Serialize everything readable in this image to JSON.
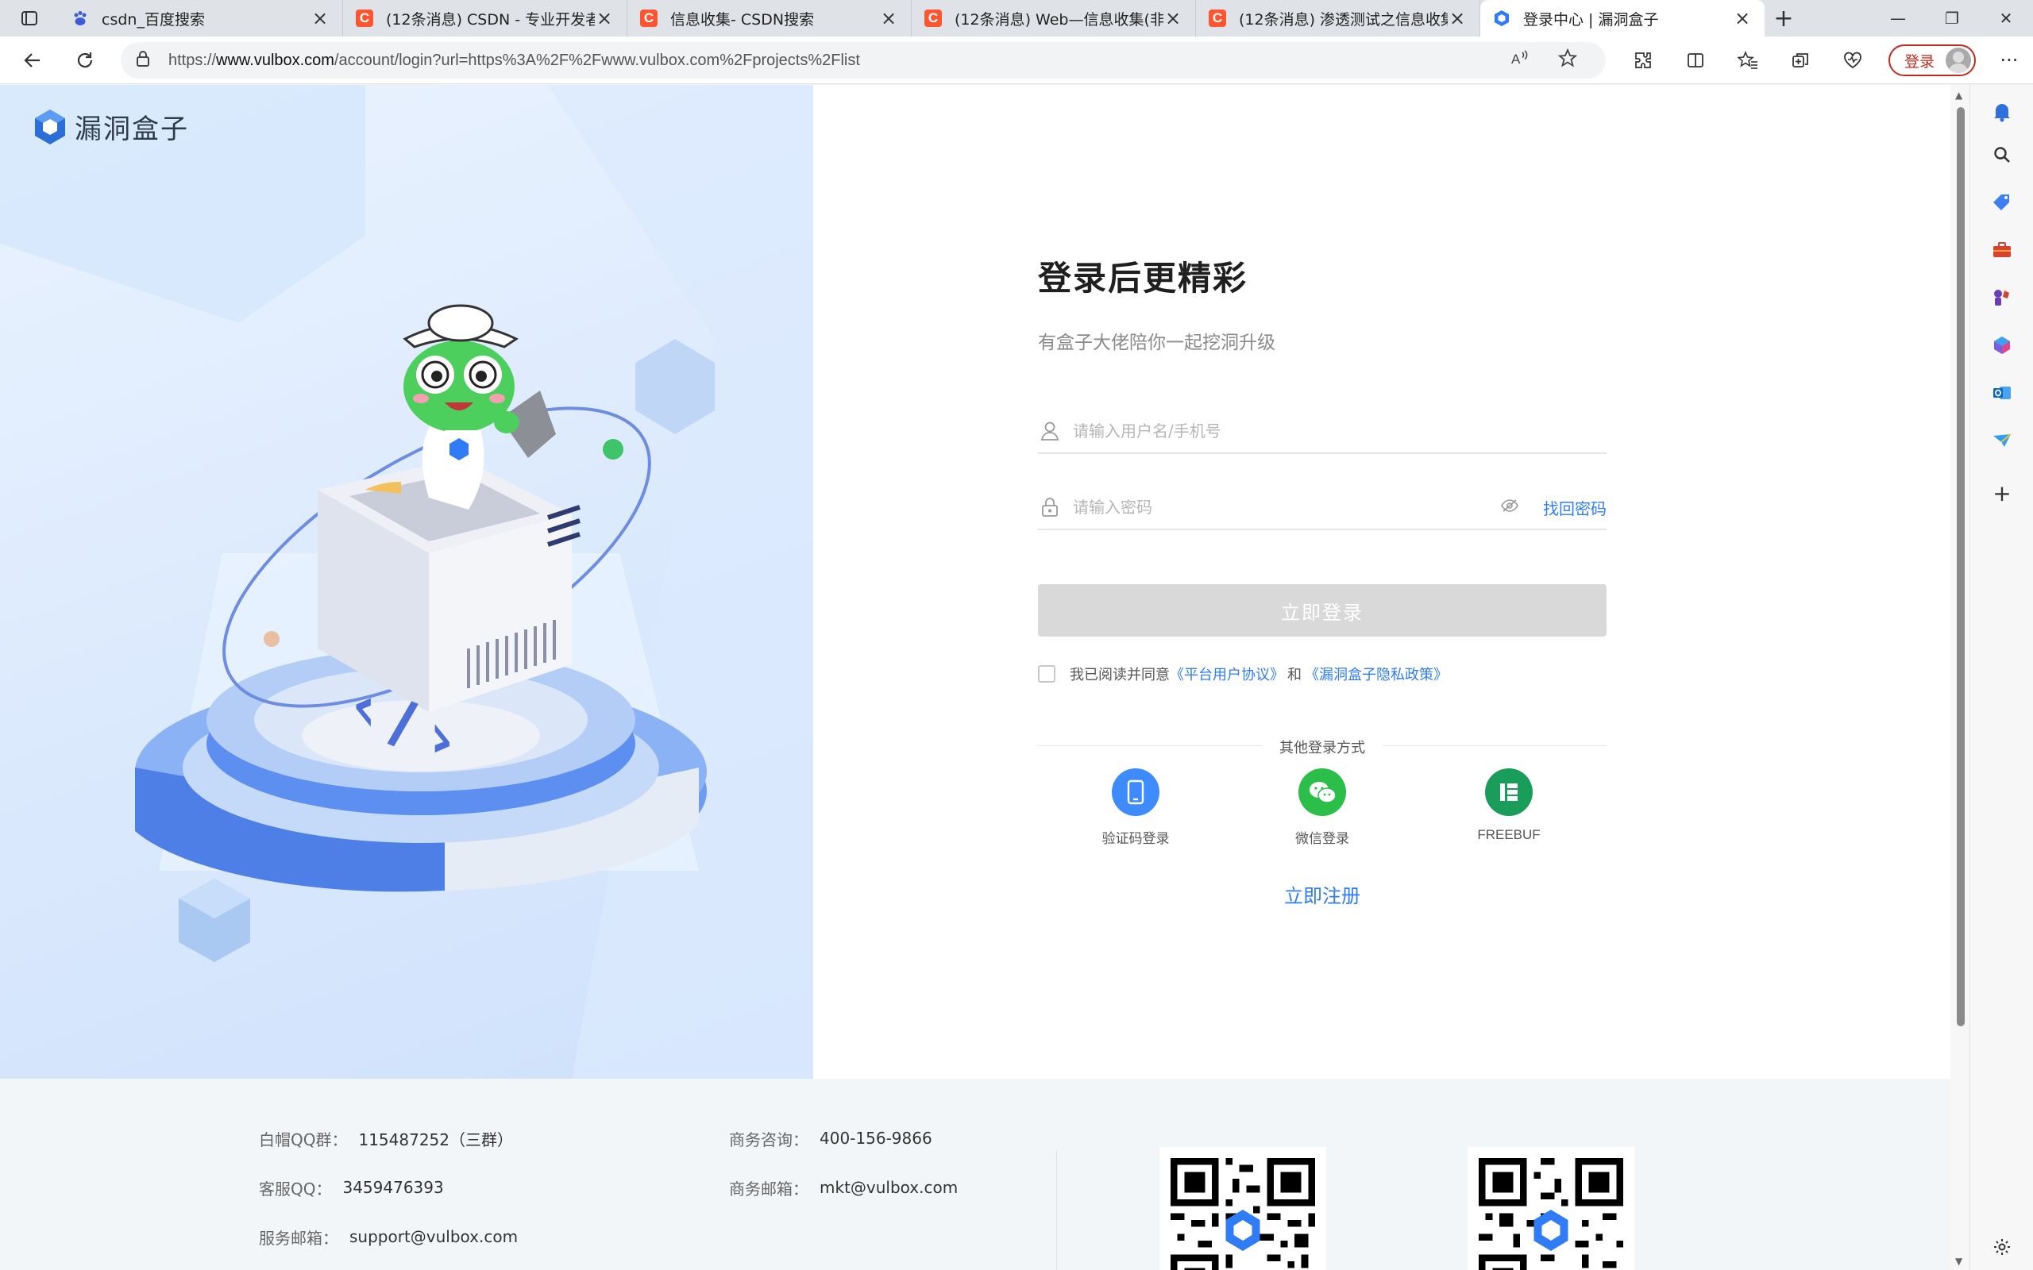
{
  "browser": {
    "tabs": [
      {
        "title": "csdn_百度搜索",
        "favicon": "baidu-paw-icon",
        "active": false
      },
      {
        "title": "(12条消息) CSDN - 专业开发者社",
        "favicon": "csdn-icon",
        "active": false
      },
      {
        "title": "信息收集- CSDN搜索",
        "favicon": "csdn-icon",
        "active": false
      },
      {
        "title": "(12条消息) Web—信息收集(非常",
        "favicon": "csdn-icon",
        "active": false
      },
      {
        "title": "(12条消息) 渗透测试之信息收集",
        "favicon": "csdn-icon",
        "active": false
      },
      {
        "title": "登录中心 | 漏洞盒子",
        "favicon": "vulbox-icon",
        "active": true
      }
    ],
    "url_prefix": "https://",
    "url_host": "www.vulbox.com",
    "url_path": "/account/login?url=https%3A%2F%2Fwww.vulbox.com%2Fprojects%2Flist",
    "profile_label": "登录",
    "accent": "#c42b1c"
  },
  "brand": {
    "name": "漏洞盒子",
    "primary_color": "#2f7cf6"
  },
  "login": {
    "title": "登录后更精彩",
    "subtitle": "有盒子大佬陪你一起挖洞升级",
    "username_placeholder": "请输入用户名/手机号",
    "password_placeholder": "请输入密码",
    "forgot_label": "找回密码",
    "submit_label": "立即登录",
    "agree_prefix": "我已阅读并同意",
    "agree_terms": "《平台用户协议》",
    "agree_and": "和",
    "agree_privacy": "《漏洞盒子隐私政策》",
    "other_title": "其他登录方式",
    "other_methods": [
      {
        "label": "验证码登录",
        "icon": "phone-icon",
        "color": "#3d8bfd"
      },
      {
        "label": "微信登录",
        "icon": "wechat-icon",
        "color": "#2bbf4a"
      },
      {
        "label": "FREEBUF",
        "icon": "freebuf-icon",
        "color": "#1a9d5a"
      }
    ],
    "register_label": "立即注册"
  },
  "footer": {
    "col1": [
      {
        "key": "白帽QQ群：",
        "value": "115487252（三群）"
      },
      {
        "key": "客服QQ：",
        "value": "3459476393"
      },
      {
        "key": "服务邮箱：",
        "value": "support@vulbox.com"
      }
    ],
    "col2": [
      {
        "key": "商务咨询：",
        "value": "400-156-9866"
      },
      {
        "key": "商务邮箱：",
        "value": "mkt@vulbox.com"
      }
    ]
  }
}
